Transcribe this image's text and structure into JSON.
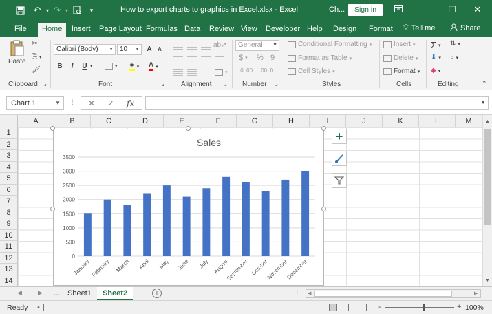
{
  "titlebar": {
    "title": "How to export charts to graphics in Excel.xlsx  -  Excel",
    "ch_label": "Ch...",
    "signin_label": "Sign in",
    "icons": [
      "save-icon",
      "undo-icon",
      "redo-icon",
      "print-preview-icon",
      "customize-qat-icon",
      "ribbon-display-icon",
      "minimize-icon",
      "maximize-icon",
      "close-icon"
    ]
  },
  "menu": {
    "tabs": [
      "File",
      "Home",
      "Insert",
      "Page Layout",
      "Formulas",
      "Data",
      "Review",
      "View",
      "Developer",
      "Help",
      "Design",
      "Format"
    ],
    "active": "Home",
    "tell_me": "Tell me",
    "share": "Share"
  },
  "ribbon": {
    "clipboard": {
      "label": "Clipboard",
      "paste": "Paste"
    },
    "font": {
      "label": "Font",
      "font_name": "Calibri (Body)",
      "font_size": "10",
      "bold": "B",
      "italic": "I",
      "underline": "U",
      "grow": "A",
      "shrink": "A"
    },
    "alignment": {
      "label": "Alignment"
    },
    "number": {
      "label": "Number",
      "format": "General",
      "currency": "$",
      "percent": "%",
      "comma": "9",
      "inc_decimal": ".0 .00",
      "dec_decimal": ".00 .0"
    },
    "styles": {
      "label": "Styles",
      "conditional": "Conditional Formatting",
      "table": "Format as Table",
      "cell_styles": "Cell Styles"
    },
    "cells": {
      "label": "Cells",
      "insert": "Insert",
      "delete": "Delete",
      "format": "Format"
    },
    "editing": {
      "label": "Editing"
    }
  },
  "formula_bar": {
    "name_box": "Chart 1",
    "formula": ""
  },
  "grid": {
    "columns": [
      "A",
      "B",
      "C",
      "D",
      "E",
      "F",
      "G",
      "H",
      "I",
      "J",
      "K",
      "L",
      "M"
    ],
    "rows": [
      "1",
      "2",
      "3",
      "4",
      "5",
      "6",
      "7",
      "8",
      "9",
      "10",
      "11",
      "12",
      "13",
      "14"
    ]
  },
  "chart_data": {
    "type": "bar",
    "title": "Sales",
    "categories": [
      "January",
      "February",
      "March",
      "April",
      "May",
      "June",
      "July",
      "August",
      "September",
      "October",
      "November",
      "December"
    ],
    "values": [
      1500,
      2000,
      1800,
      2200,
      2500,
      2100,
      2400,
      2800,
      2600,
      2300,
      2700,
      3000
    ],
    "yticks": [
      "0",
      "500",
      "1000",
      "1500",
      "2000",
      "2500",
      "3000",
      "3500"
    ],
    "ylim": [
      0,
      3500
    ],
    "xlabel": "",
    "ylabel": "",
    "grid": true,
    "bar_color": "#4472c4"
  },
  "chart_side_buttons": [
    "chart-elements-icon",
    "chart-styles-icon",
    "chart-filters-icon"
  ],
  "sheets": {
    "tabs": [
      "Sheet1",
      "Sheet2"
    ],
    "active": "Sheet2"
  },
  "status": {
    "text": "Ready",
    "zoom": "100%",
    "zoom_minus": "-",
    "zoom_plus": "+"
  },
  "colors": {
    "brand": "#217346",
    "bar": "#4472c4"
  }
}
